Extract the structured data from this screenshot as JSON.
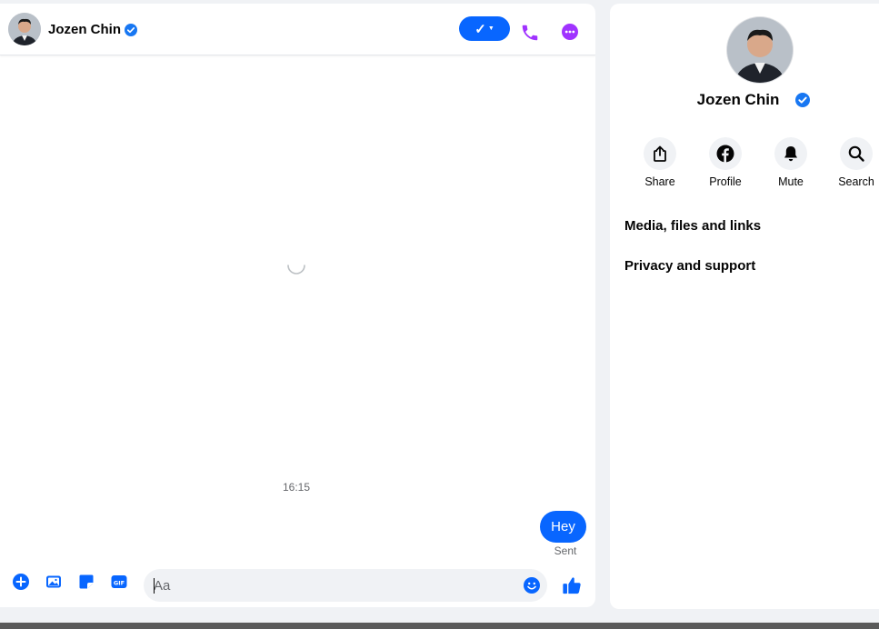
{
  "chat": {
    "contact_name": "Jozen Chin",
    "timestamp": "16:15",
    "messages": [
      {
        "text": "Hey",
        "status": "Sent"
      }
    ],
    "composer": {
      "placeholder": "Aa"
    }
  },
  "profile": {
    "name": "Jozen Chin",
    "actions": [
      {
        "label": "Share",
        "icon": "share-icon"
      },
      {
        "label": "Profile",
        "icon": "facebook-icon"
      },
      {
        "label": "Mute",
        "icon": "bell-icon"
      },
      {
        "label": "Search",
        "icon": "search-icon"
      }
    ],
    "sections": [
      {
        "label": "Media, files and links"
      },
      {
        "label": "Privacy and support"
      }
    ]
  },
  "colors": {
    "accent": "#0866ff",
    "call_purple": "#a033ff",
    "verified": "#1877f2",
    "secondary_text": "#65676b"
  }
}
